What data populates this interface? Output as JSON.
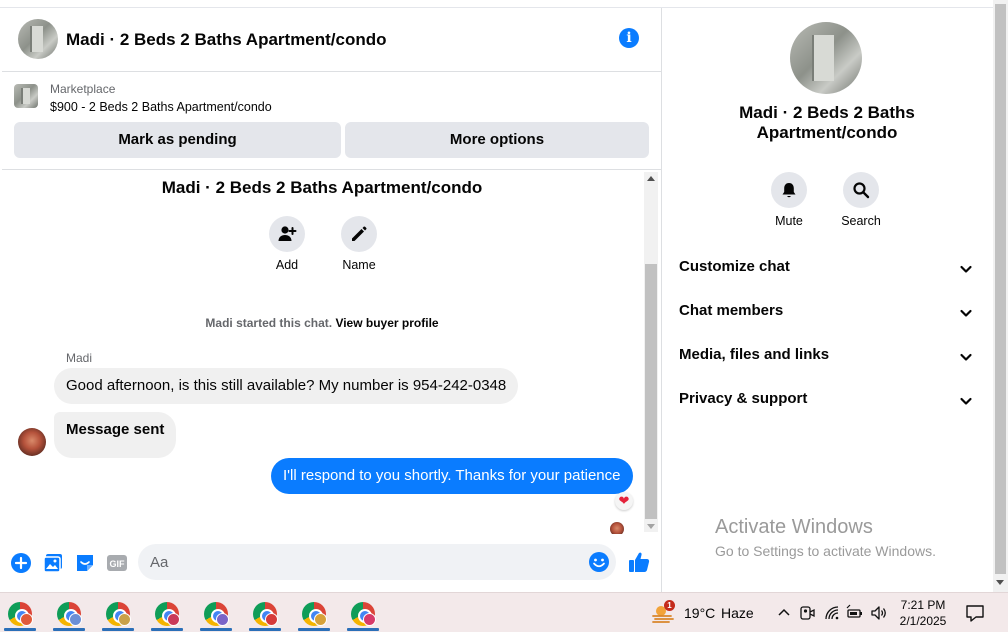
{
  "header": {
    "title": "Madi · 2 Beds 2 Baths Apartment/condo",
    "info_icon": "i"
  },
  "listing": {
    "source": "Marketplace",
    "price_title": "$900 - 2 Beds 2 Baths Apartment/condo",
    "mark_pending_label": "Mark as pending",
    "more_options_label": "More options"
  },
  "thread": {
    "title": "Madi · 2 Beds 2 Baths Apartment/condo",
    "actions": {
      "add_label": "Add",
      "name_label": "Name"
    },
    "started_text": "Madi started this chat. ",
    "view_profile_link": "View buyer profile",
    "sender_name": "Madi",
    "messages": [
      {
        "from": "Madi",
        "text": "Good afternoon, is this still available? My number is 954-242-0348"
      },
      {
        "from": "Madi",
        "text": "Message sent"
      },
      {
        "from": "me",
        "text": "I'll respond to you shortly. Thanks for your patience",
        "reaction": "heart"
      }
    ],
    "reaction_glyph": "❤"
  },
  "composer": {
    "placeholder": "Aa",
    "gif_label": "GIF"
  },
  "details": {
    "title": "Madi · 2 Beds 2 Baths Apartment/condo",
    "mute_label": "Mute",
    "search_label": "Search",
    "sections": [
      {
        "label": "Customize chat"
      },
      {
        "label": "Chat members"
      },
      {
        "label": "Media, files and links"
      },
      {
        "label": "Privacy & support"
      }
    ]
  },
  "windows_watermark": {
    "line1": "Activate Windows",
    "line2": "Go to Settings to activate Windows."
  },
  "taskbar": {
    "apps": [
      {
        "name": "chrome",
        "profile_color": "#e05a3a"
      },
      {
        "name": "chrome",
        "profile_color": "#6b8fd6"
      },
      {
        "name": "chrome",
        "profile_color": "#c9a14a"
      },
      {
        "name": "chrome",
        "profile_color": "#c93a5a"
      },
      {
        "name": "chrome",
        "profile_color": "#7a64c8"
      },
      {
        "name": "chrome",
        "profile_color": "#d63a3a"
      },
      {
        "name": "chrome",
        "profile_color": "#d6a13a"
      },
      {
        "name": "chrome",
        "profile_color": "#d63a6a"
      }
    ],
    "weather_badge": "1",
    "temperature": "19°C",
    "condition": "Haze",
    "time": "7:21 PM",
    "date": "2/1/2025"
  },
  "colors": {
    "messenger_blue": "#0a7cff",
    "bubble_gray": "#f0f0f0",
    "button_gray": "#e4e6eb",
    "taskbar": "#f3e9ea"
  }
}
